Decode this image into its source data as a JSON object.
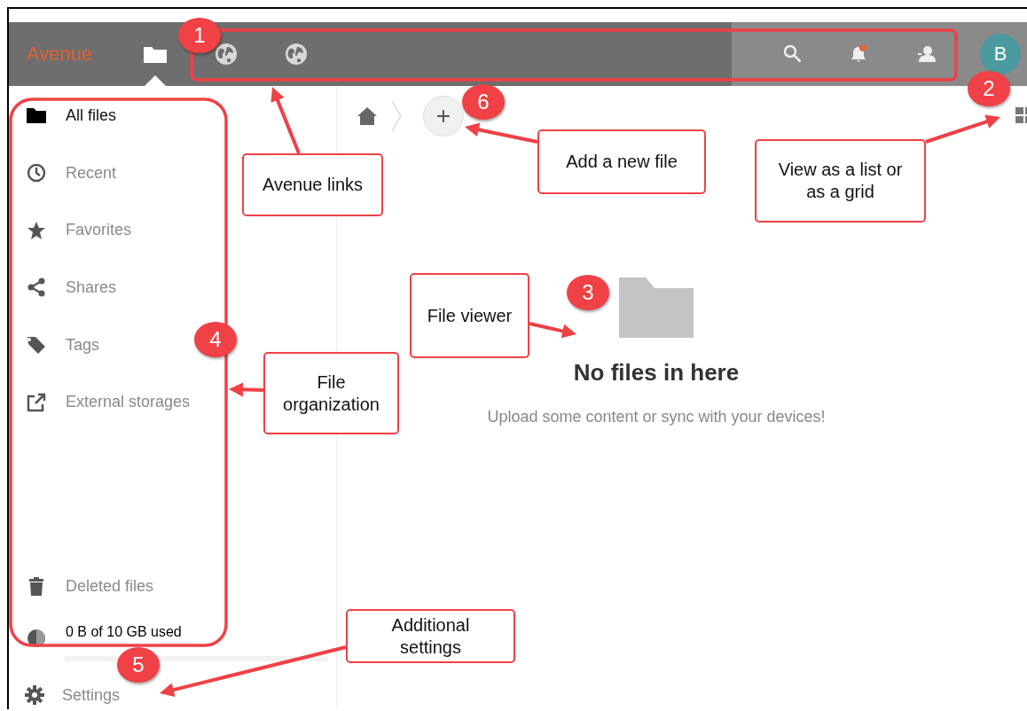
{
  "topbar": {
    "logo": "Avenue",
    "notification_unread": true,
    "avatar_initial": "B"
  },
  "sidebar": {
    "items": [
      {
        "label": "All files",
        "selected": true
      },
      {
        "label": "Recent",
        "selected": false
      },
      {
        "label": "Favorites",
        "selected": false
      },
      {
        "label": "Shares",
        "selected": false
      },
      {
        "label": "Tags",
        "selected": false
      },
      {
        "label": "External storages",
        "selected": false
      }
    ],
    "deleted": "Deleted files",
    "quota": {
      "text": "0 B of 10 GB used"
    },
    "settings": "Settings"
  },
  "toolbar": {
    "add_symbol": "+"
  },
  "empty_state": {
    "title": "No files in here",
    "subtitle": "Upload some content or sync with your devices!"
  },
  "annotations": {
    "badges": [
      "1",
      "2",
      "3",
      "4",
      "5",
      "6"
    ],
    "callouts": [
      "Avenue links",
      "Add a new file",
      "View as a list or as a grid",
      "File viewer",
      "File organization",
      "Additional settings"
    ]
  }
}
